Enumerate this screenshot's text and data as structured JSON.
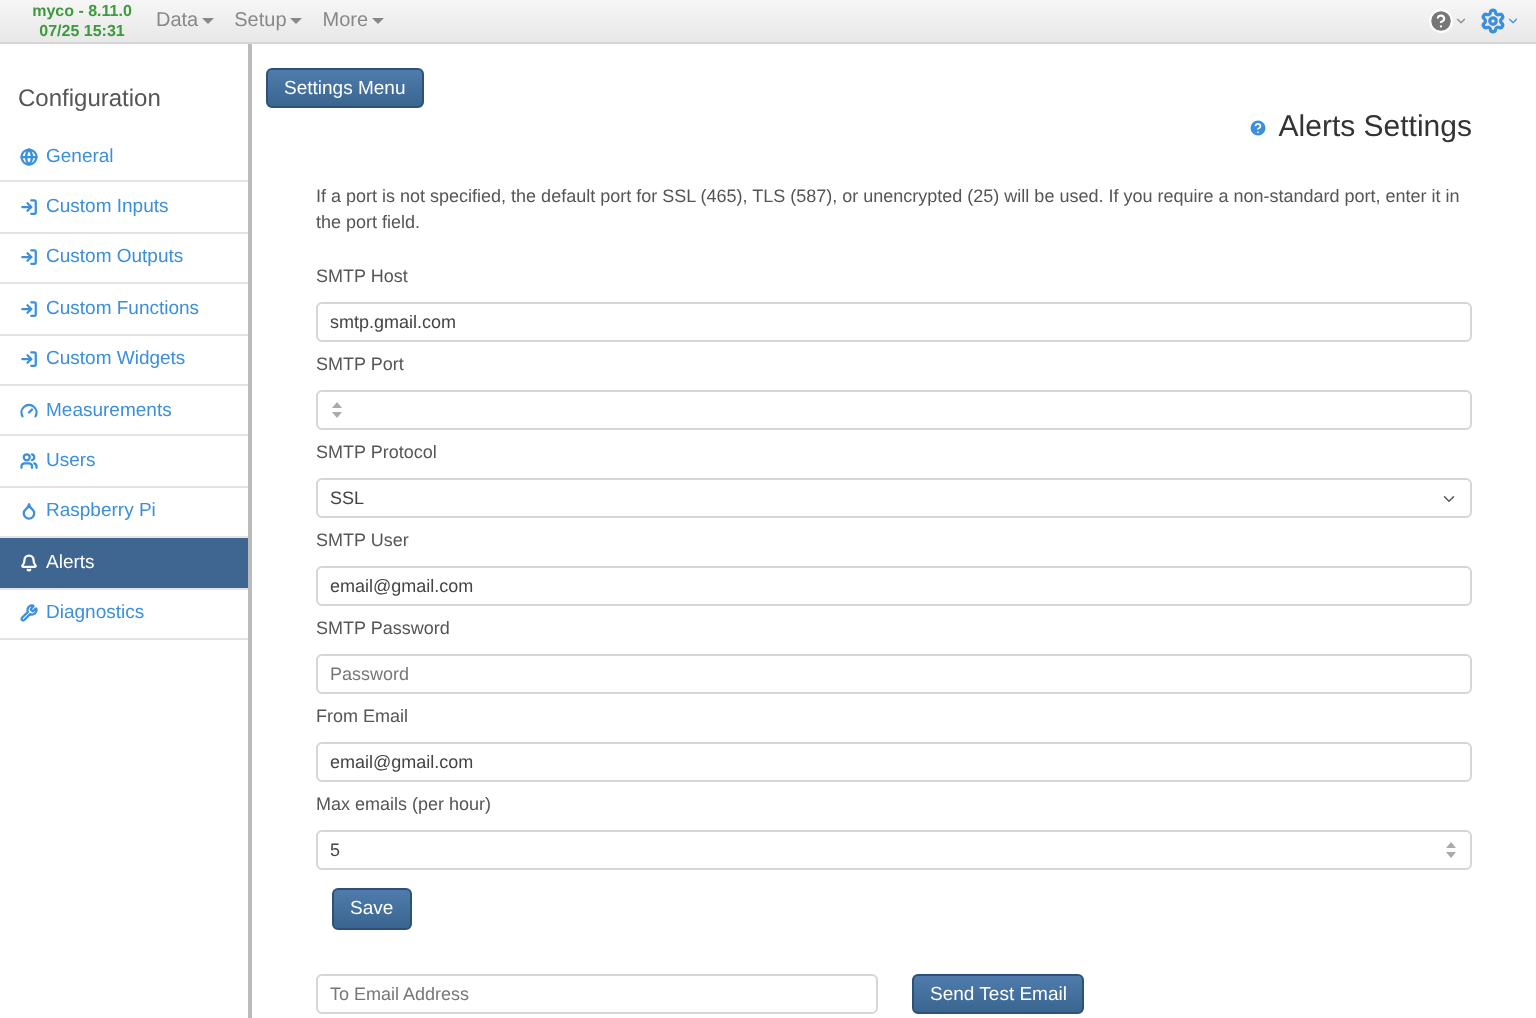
{
  "navbar": {
    "brand": "myco - 8.11.0",
    "datetime": "07/25 15:31",
    "menus": [
      "Data",
      "Setup",
      "More"
    ]
  },
  "sidebar": {
    "title": "Configuration",
    "items": [
      {
        "label": "General",
        "selected": false
      },
      {
        "label": "Custom Inputs",
        "selected": false
      },
      {
        "label": "Custom Outputs",
        "selected": false
      },
      {
        "label": "Custom Functions",
        "selected": false
      },
      {
        "label": "Custom Widgets",
        "selected": false
      },
      {
        "label": "Measurements",
        "selected": false
      },
      {
        "label": "Users",
        "selected": false
      },
      {
        "label": "Raspberry Pi",
        "selected": false
      },
      {
        "label": "Alerts",
        "selected": true
      },
      {
        "label": "Diagnostics",
        "selected": false
      }
    ]
  },
  "settings_menu_button": "Settings Menu",
  "page_title": "Alerts Settings",
  "description": "If a port is not specified, the default port for SSL (465), TLS (587), or unencrypted (25) will be used. If you require a non-standard port, enter it in the port field.",
  "fields": [
    {
      "label": "SMTP Host",
      "kind": "text",
      "value": "smtp.gmail.com"
    },
    {
      "label": "SMTP Port",
      "kind": "number"
    },
    {
      "label": "SMTP Protocol",
      "kind": "select",
      "value": "SSL"
    },
    {
      "label": "SMTP User",
      "kind": "text",
      "value": "email@gmail.com"
    },
    {
      "label": "SMTP Password",
      "kind": "text",
      "placeholder": "Password"
    },
    {
      "label": "From Email",
      "kind": "text",
      "value": "email@gmail.com"
    },
    {
      "label": "Max emails (per hour)",
      "kind": "number",
      "value": "5"
    }
  ],
  "save_button": "Save",
  "test_email": {
    "placeholder": "To Email Address",
    "button": "Send Test Email"
  }
}
